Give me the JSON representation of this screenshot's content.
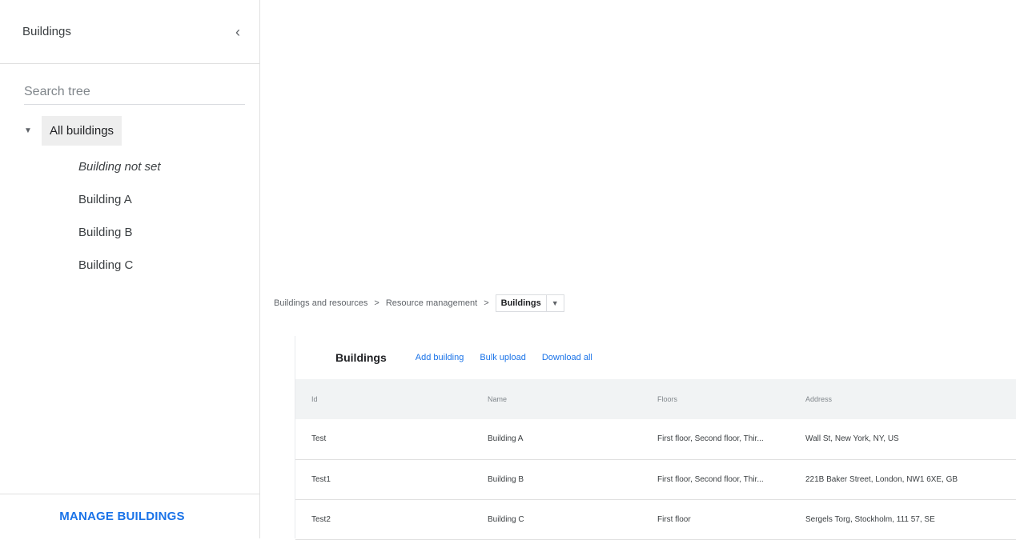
{
  "sidebar": {
    "title": "Buildings",
    "collapse_icon": "chevron-left-icon",
    "search_placeholder": "Search tree",
    "root_label": "All buildings",
    "items": [
      {
        "label": "Building not set",
        "italic": true
      },
      {
        "label": "Building A"
      },
      {
        "label": "Building B"
      },
      {
        "label": "Building C"
      }
    ],
    "manage_label": "MANAGE BUILDINGS"
  },
  "breadcrumb": {
    "items": [
      "Buildings and resources",
      "Resource management"
    ],
    "current": "Buildings",
    "separator": ">"
  },
  "panel": {
    "title": "Buildings",
    "actions": [
      "Add building",
      "Bulk upload",
      "Download all"
    ],
    "columns": [
      "Id",
      "Name",
      "Floors",
      "Address"
    ],
    "rows": [
      [
        "Test",
        "Building A",
        "First floor, Second floor, Thir...",
        "Wall St, New York, NY, US"
      ],
      [
        "Test1",
        "Building B",
        "First floor, Second floor, Thir...",
        "221B Baker Street, London, NW1 6XE, GB"
      ],
      [
        "Test2",
        "Building C",
        "First floor",
        "Sergels Torg, Stockholm, 111 57, SE"
      ]
    ]
  },
  "colors": {
    "accent": "#1a73e8",
    "header_bg": "#f1f3f4"
  }
}
